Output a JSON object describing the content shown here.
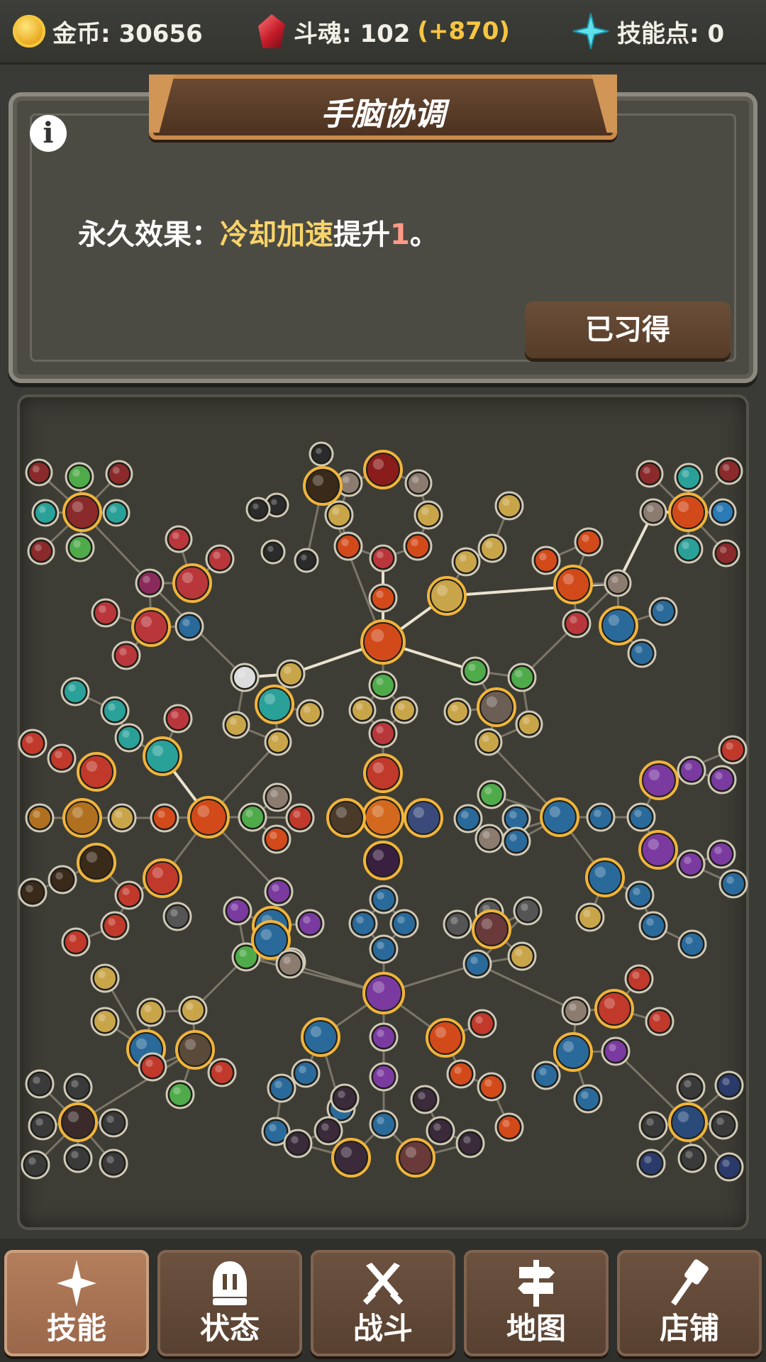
{
  "topbar": {
    "gold": {
      "label": "金币",
      "value": "30656",
      "icon": "gold-coin-icon"
    },
    "soul": {
      "label": "斗魂",
      "value": "102",
      "bonus": "(+870)",
      "icon": "red-crystal-icon"
    },
    "skill_points": {
      "label": "技能点",
      "value": "0",
      "icon": "cyan-star-icon"
    }
  },
  "panel": {
    "title": "手脑协调",
    "effect_prefix": "永久效果：",
    "effect_stat": "冷却加速",
    "effect_mid": "提升",
    "effect_value": "1",
    "effect_suffix": "。",
    "status_button": "已习得"
  },
  "nav": [
    {
      "label": "技能",
      "icon": "sparkle-icon",
      "active": true
    },
    {
      "label": "状态",
      "icon": "helmet-icon",
      "active": false
    },
    {
      "label": "战斗",
      "icon": "crossed-swords-icon",
      "active": false
    },
    {
      "label": "地图",
      "icon": "signpost-icon",
      "active": false
    },
    {
      "label": "店铺",
      "icon": "hammer-icon",
      "active": false
    }
  ],
  "colors": {
    "accent_gold": "#f7d36a",
    "bonus_yellow": "#f6c542",
    "value_pink": "#ff9b86",
    "nav_active": "#b47f5c",
    "nav_idle": "#6d5240"
  }
}
